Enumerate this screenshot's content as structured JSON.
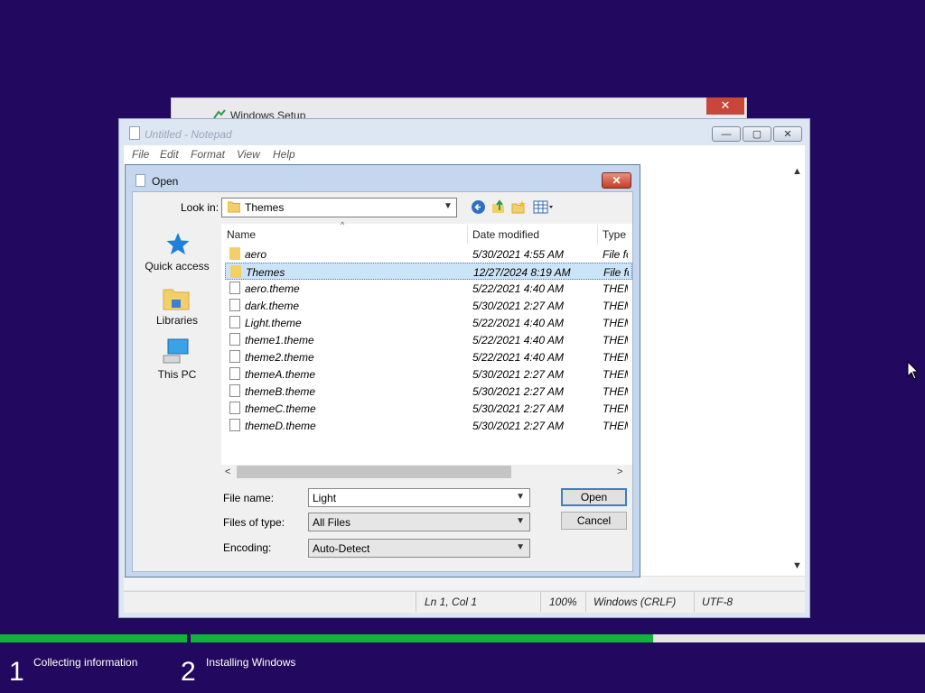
{
  "setup_window": {
    "title": "Windows Setup",
    "close": "✕"
  },
  "notepad": {
    "title": "Untitled - Notepad",
    "menu": [
      "File",
      "Edit",
      "Format",
      "View",
      "Help"
    ],
    "caption_buttons": {
      "minimize": "—",
      "maximize": "▢",
      "close": "✕"
    },
    "status": {
      "position": "Ln 1, Col 1",
      "zoom": "100%",
      "line_ending": "Windows (CRLF)",
      "encoding": "UTF-8"
    }
  },
  "open_dialog": {
    "title": "Open",
    "close": "✕",
    "look_in_label": "Look in:",
    "look_in_value": "Themes",
    "places": [
      "Quick access",
      "Libraries",
      "This PC"
    ],
    "columns": [
      "Name",
      "Date modified",
      "Type"
    ],
    "rows": [
      {
        "name": "aero",
        "date": "5/30/2021 4:55 AM",
        "type": "File folder",
        "kind": "folder"
      },
      {
        "name": "Themes",
        "date": "12/27/2024 8:19 AM",
        "type": "File folder",
        "kind": "folder",
        "selected": true
      },
      {
        "name": "aero.theme",
        "date": "5/22/2021 4:40 AM",
        "type": "THEME",
        "kind": "file"
      },
      {
        "name": "dark.theme",
        "date": "5/30/2021 2:27 AM",
        "type": "THEME",
        "kind": "file"
      },
      {
        "name": "Light.theme",
        "date": "5/22/2021 4:40 AM",
        "type": "THEME",
        "kind": "file"
      },
      {
        "name": "theme1.theme",
        "date": "5/22/2021 4:40 AM",
        "type": "THEME",
        "kind": "file"
      },
      {
        "name": "theme2.theme",
        "date": "5/22/2021 4:40 AM",
        "type": "THEME",
        "kind": "file"
      },
      {
        "name": "themeA.theme",
        "date": "5/30/2021 2:27 AM",
        "type": "THEME",
        "kind": "file"
      },
      {
        "name": "themeB.theme",
        "date": "5/30/2021 2:27 AM",
        "type": "THEME",
        "kind": "file"
      },
      {
        "name": "themeC.theme",
        "date": "5/30/2021 2:27 AM",
        "type": "THEME",
        "kind": "file"
      },
      {
        "name": "themeD.theme",
        "date": "5/30/2021 2:27 AM",
        "type": "THEME",
        "kind": "file"
      }
    ],
    "file_name_label": "File name:",
    "file_name_value": "Light",
    "file_type_label": "Files of type:",
    "file_type_value": "All Files",
    "encoding_label": "Encoding:",
    "encoding_value": "Auto-Detect",
    "open_button": "Open",
    "cancel_button": "Cancel"
  },
  "setup_progress": {
    "step1": {
      "number": "1",
      "label": "Collecting information",
      "progress": 1.0
    },
    "step2": {
      "number": "2",
      "label": "Installing Windows",
      "progress": 0.63
    }
  },
  "colors": {
    "background": "#22085e",
    "progress_green": "#10b538",
    "selection": "#cce4f7"
  }
}
